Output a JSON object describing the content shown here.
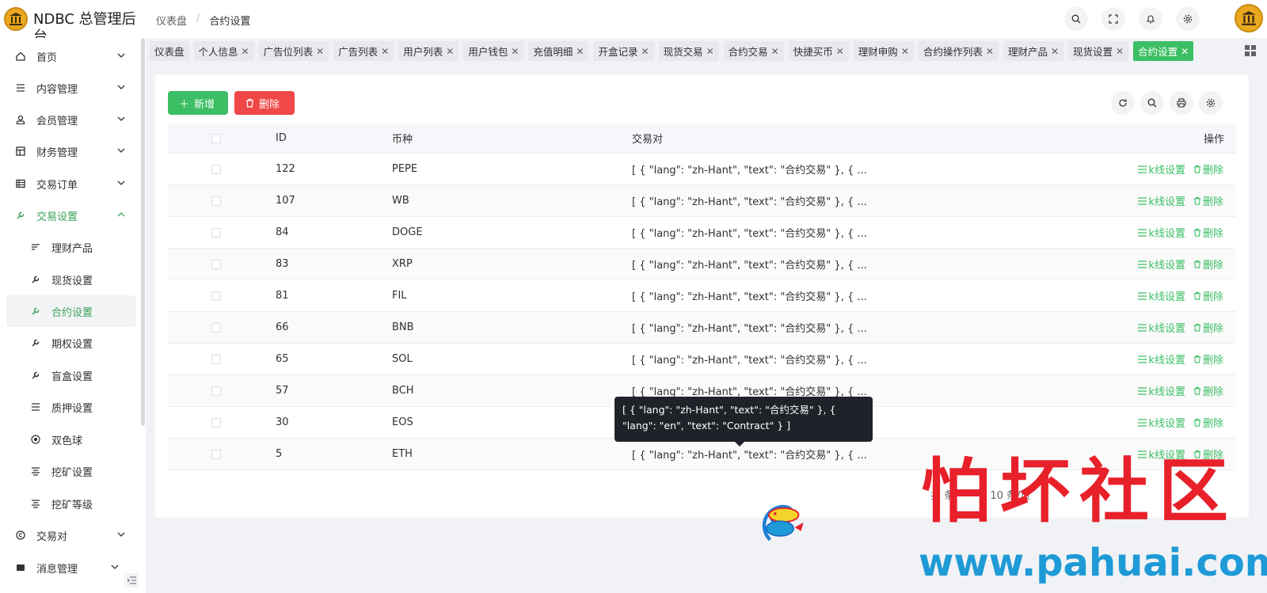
{
  "header": {
    "app_title": "NDBC 总管理后台",
    "breadcrumb": [
      "仪表盘",
      "合约设置"
    ],
    "breadcrumb_sep": "/"
  },
  "sidebar": {
    "items": [
      {
        "label": "首页",
        "icon": "home-icon",
        "expandable": true
      },
      {
        "label": "内容管理",
        "icon": "list-icon",
        "expandable": true
      },
      {
        "label": "会员管理",
        "icon": "user-icon",
        "expandable": true
      },
      {
        "label": "财务管理",
        "icon": "layout-icon",
        "expandable": true
      },
      {
        "label": "交易订单",
        "icon": "table-icon",
        "expandable": true
      },
      {
        "label": "交易设置",
        "icon": "wrench-icon",
        "expandable": true,
        "open": true
      },
      {
        "label": "理财产品",
        "icon": "sort-icon",
        "sub": true
      },
      {
        "label": "现货设置",
        "icon": "wrench-icon",
        "sub": true
      },
      {
        "label": "合约设置",
        "icon": "wrench-icon",
        "sub": true,
        "active": true
      },
      {
        "label": "期权设置",
        "icon": "wrench-icon",
        "sub": true
      },
      {
        "label": "盲盒设置",
        "icon": "wrench-icon",
        "sub": true
      },
      {
        "label": "质押设置",
        "icon": "list-icon",
        "sub": true
      },
      {
        "label": "双色球",
        "icon": "radio-icon",
        "sub": true
      },
      {
        "label": "挖矿设置",
        "icon": "align-icon",
        "sub": true
      },
      {
        "label": "挖矿等级",
        "icon": "align-icon",
        "sub": true
      },
      {
        "label": "交易对",
        "icon": "copyright-icon",
        "expandable": true
      },
      {
        "label": "消息管理",
        "icon": "message-icon",
        "expandable": true
      }
    ]
  },
  "tabs": [
    {
      "label": "仪表盘",
      "closable": false
    },
    {
      "label": "个人信息",
      "closable": true
    },
    {
      "label": "广告位列表",
      "closable": true
    },
    {
      "label": "广告列表",
      "closable": true
    },
    {
      "label": "用户列表",
      "closable": true
    },
    {
      "label": "用户钱包",
      "closable": true
    },
    {
      "label": "充值明细",
      "closable": true
    },
    {
      "label": "开盒记录",
      "closable": true
    },
    {
      "label": "现货交易",
      "closable": true
    },
    {
      "label": "合约交易",
      "closable": true
    },
    {
      "label": "快捷买币",
      "closable": true
    },
    {
      "label": "理财申购",
      "closable": true
    },
    {
      "label": "合约操作列表",
      "closable": true
    },
    {
      "label": "理财产品",
      "closable": true
    },
    {
      "label": "现货设置",
      "closable": true
    },
    {
      "label": "合约设置",
      "closable": true,
      "active": true
    }
  ],
  "toolbar": {
    "add_label": "新增",
    "delete_label": "删除"
  },
  "table": {
    "columns": [
      "ID",
      "币种",
      "交易对",
      "操作"
    ],
    "rows": [
      {
        "id": "122",
        "coin": "PEPE",
        "pair": "[ { \"lang\": \"zh-Hant\", \"text\": \"合约交易\" }, { ..."
      },
      {
        "id": "107",
        "coin": "WB",
        "pair": "[ { \"lang\": \"zh-Hant\", \"text\": \"合约交易\" }, { ..."
      },
      {
        "id": "84",
        "coin": "DOGE",
        "pair": "[ { \"lang\": \"zh-Hant\", \"text\": \"合约交易\" }, { ..."
      },
      {
        "id": "83",
        "coin": "XRP",
        "pair": "[ { \"lang\": \"zh-Hant\", \"text\": \"合约交易\" }, { ..."
      },
      {
        "id": "81",
        "coin": "FIL",
        "pair": "[ { \"lang\": \"zh-Hant\", \"text\": \"合约交易\" }, { ..."
      },
      {
        "id": "66",
        "coin": "BNB",
        "pair": "[ { \"lang\": \"zh-Hant\", \"text\": \"合约交易\" }, { ..."
      },
      {
        "id": "65",
        "coin": "SOL",
        "pair": "[ { \"lang\": \"zh-Hant\", \"text\": \"合约交易\" }, { ..."
      },
      {
        "id": "57",
        "coin": "BCH",
        "pair": "[ { \"lang\": \"zh-Hant\", \"text\": \"合约交易\" }, { ..."
      },
      {
        "id": "30",
        "coin": "EOS",
        "pair": "[ { \"lang\": \"zh-Hant\", \"text\": \"合约交易\" }, { ..."
      },
      {
        "id": "5",
        "coin": "ETH",
        "pair": "[ { \"lang\": \"zh-Hant\", \"text\": \"合约交易\" }, { ..."
      }
    ],
    "row_actions": {
      "kline": "k线设置",
      "delete": "删除"
    }
  },
  "pager": {
    "total_prefix": "共",
    "total_suffix": "条",
    "page_size": "10 条/页"
  },
  "tooltip": {
    "text": "[ { \"lang\": \"zh-Hant\", \"text\": \"合约交易\" }, { \"lang\": \"en\", \"text\": \"Contract\" } ]"
  },
  "watermark": {
    "title": "怕坏社区",
    "url": "www.pahuai.com"
  },
  "colors": {
    "accent": "#3cbf64",
    "danger": "#f04848",
    "watermark_red": "#e8202a",
    "watermark_blue": "#1e9ad6"
  }
}
